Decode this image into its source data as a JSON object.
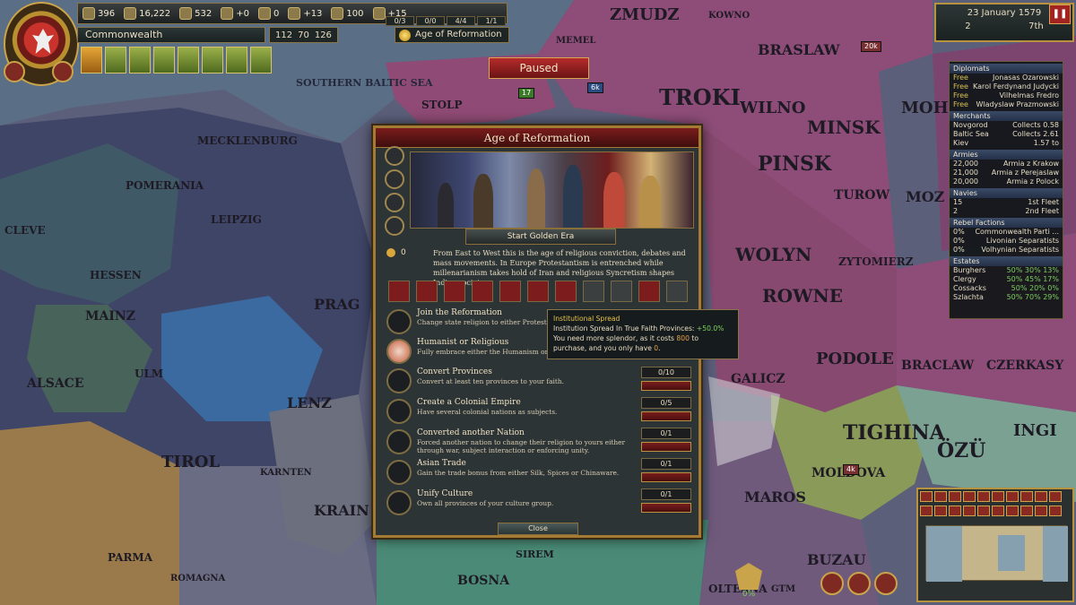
{
  "resources": [
    "396",
    "16,222",
    "532",
    "+0",
    "0",
    "+13",
    "100",
    "+15"
  ],
  "counters": [
    "0/3",
    "0/0",
    "4/4",
    "1/1"
  ],
  "country": "Commonwealth",
  "points": [
    "112",
    "70",
    "126"
  ],
  "age_label": "Age of Reformation",
  "paused": "Paused",
  "date": "23 January 1579",
  "speed": "2",
  "rank": "7th",
  "map_labels": {
    "zmudz": "ZMUDZ",
    "kowno": "KOWNO",
    "braslaw": "BRASLAW",
    "memel": "MEMEL",
    "baltic": "SOUTHERN BALTIC SEA",
    "troki": "TROKI",
    "wilno": "WILNO",
    "minsk": "MINSK",
    "pinsk": "PINSK",
    "turow": "TUROW",
    "wolyn": "WOLYN",
    "rowne": "ROWNE",
    "zytomierz": "ZYTOMIERZ",
    "podole": "PODOLE",
    "braclaw": "BRACLAW",
    "czerkasy": "CZERKASY",
    "tighina": "TIGHINA",
    "ozu": "ÖZÜ",
    "moldova": "MOLDOVA",
    "maros": "MAROS",
    "buzau": "BUZAU",
    "olteana": "OLTEANA",
    "bosna": "BOSNA",
    "sirem": "SIREM",
    "lenz": "LENZ",
    "tirol": "TIROL",
    "karnten": "KARNTEN",
    "krain": "KRAIN",
    "prag": "PRAG",
    "leipzig": "LEIPZIG",
    "mainz": "MAINZ",
    "ulm": "ULM",
    "parma": "PARMA",
    "romagna": "ROMAGNA",
    "cleve": "CLEVE",
    "hessen": "HESSEN",
    "alsace": "ALSACE",
    "mecklenburg": "MECKLENBURG",
    "pomerania": "POMERANIA",
    "stolp": "STOLP",
    "mogilev": "MOH",
    "moz": "MOZ",
    "ingi": "INGI",
    "galicz": "GALICZ",
    "gtm": "GTM"
  },
  "units": [
    "20k",
    "17",
    "6k",
    "4k"
  ],
  "ledger": {
    "diplomats_title": "Diplomats",
    "diplomats": [
      [
        "Free",
        "Jonasas Ozarowski"
      ],
      [
        "Free",
        "Karol Ferdynand Judycki"
      ],
      [
        "Free",
        "Vilhelmas Fredro"
      ],
      [
        "Free",
        "Wladyslaw Prazmowski"
      ]
    ],
    "merchants_title": "Merchants",
    "merchants": [
      [
        "Novgorod",
        "Collects 0.58"
      ],
      [
        "Baltic Sea",
        "Collects 2.61"
      ],
      [
        "Kiev",
        "1.57 to"
      ]
    ],
    "armies_title": "Armies",
    "armies": [
      [
        "22,000",
        "Armia z Krakow"
      ],
      [
        "21,000",
        "Armia z Perejaslaw"
      ],
      [
        "20,000",
        "Armia z Polock"
      ]
    ],
    "navies_title": "Navies",
    "navies": [
      [
        "15",
        "1st Fleet"
      ],
      [
        "2",
        "2nd Fleet"
      ]
    ],
    "rebels_title": "Rebel Factions",
    "rebels": [
      [
        "0%",
        "Commonwealth Parti ..."
      ],
      [
        "0%",
        "Livonian Separatists"
      ],
      [
        "0%",
        "Volhynian Separatists"
      ]
    ],
    "estates_title": "Estates",
    "estates": [
      [
        "Burghers",
        "50% 30% 13%"
      ],
      [
        "Clergy",
        "50% 45% 17%"
      ],
      [
        "Cossacks",
        "50% 20% 0%"
      ],
      [
        "Szlachta",
        "50% 70% 29%"
      ]
    ]
  },
  "window": {
    "title": "Age of Reformation",
    "golden_era": "Start Golden Era",
    "splendor": "0",
    "description": "From East to West this is the age of religious conviction, debates and mass movements. In Europe Protestantism is entrenched while millenarianism takes hold of Iran and religious Syncretism shapes Indian society.",
    "objectives": [
      {
        "title": "Join the Reformation",
        "desc": "Change state religion to either Protestant",
        "progress": ""
      },
      {
        "title": "Humanist or Religious",
        "desc": "Fully embrace either the Humanism or R",
        "progress": ""
      },
      {
        "title": "Convert Provinces",
        "desc": "Convert at least ten provinces to your faith.",
        "progress": "0/10"
      },
      {
        "title": "Create a Colonial Empire",
        "desc": "Have several colonial nations as subjects.",
        "progress": "0/5"
      },
      {
        "title": "Converted another Nation",
        "desc": "Forced another nation to change their religion to yours either through war, subject interaction or enforcing unity.",
        "progress": "0/1"
      },
      {
        "title": "Asian Trade",
        "desc": "Gain the trade bonus from either Silk, Spices or Chinaware.",
        "progress": "0/1"
      },
      {
        "title": "Unify Culture",
        "desc": "Own all provinces of your culture group.",
        "progress": "0/1"
      }
    ],
    "close": "Close"
  },
  "tooltip": {
    "title": "Institutional Spread",
    "line1": "Institution Spread In True Faith Provinces:",
    "line1_value": "+50.0%",
    "line2a": "You need more splendor, as it costs",
    "cost": "800",
    "line2b": "to purchase, and you only have",
    "have": "0",
    "end": "."
  },
  "minimap_pct": "0%",
  "bottom_counts": [
    "0",
    "0",
    "0"
  ]
}
